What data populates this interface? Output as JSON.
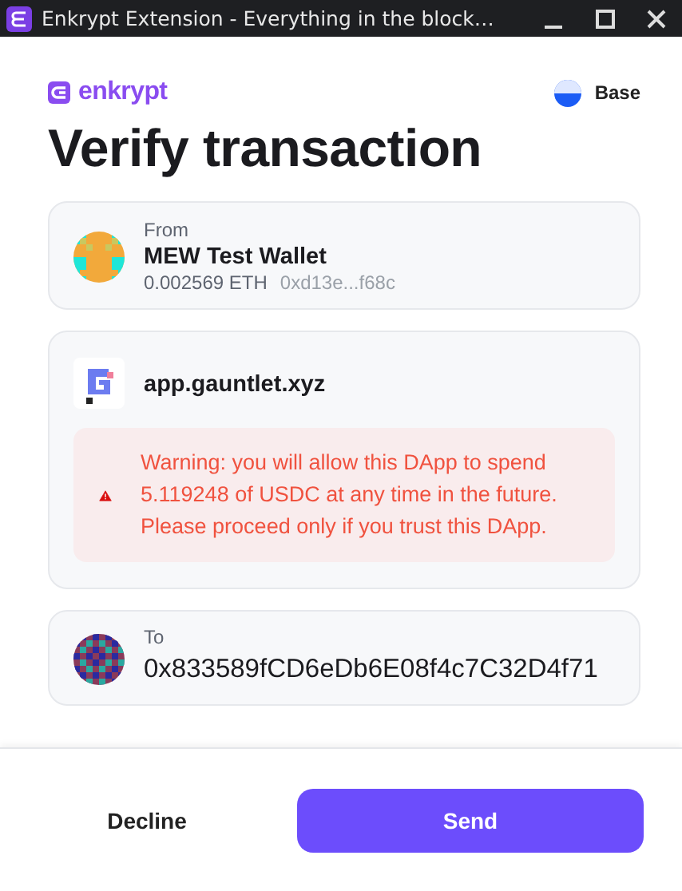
{
  "window": {
    "title": "Enkrypt Extension - Everything in the block…"
  },
  "brand": {
    "name": "enkrypt"
  },
  "network": {
    "name": "Base"
  },
  "heading": "Verify transaction",
  "from": {
    "label": "From",
    "name": "MEW Test Wallet",
    "balance": "0.002569 ETH",
    "address": "0xd13e...f68c"
  },
  "dapp": {
    "domain": "app.gauntlet.xyz",
    "warning": "Warning: you will allow this DApp to spend 5.119248 of USDC at any time in the future. Please proceed only if you trust this DApp."
  },
  "to": {
    "label": "To",
    "address": "0x833589fCD6eDb6E08f4c7C32D4f71"
  },
  "buttons": [
    {
      "label": "Decline",
      "kind": "secondary"
    },
    {
      "label": "Send",
      "kind": "primary"
    }
  ]
}
